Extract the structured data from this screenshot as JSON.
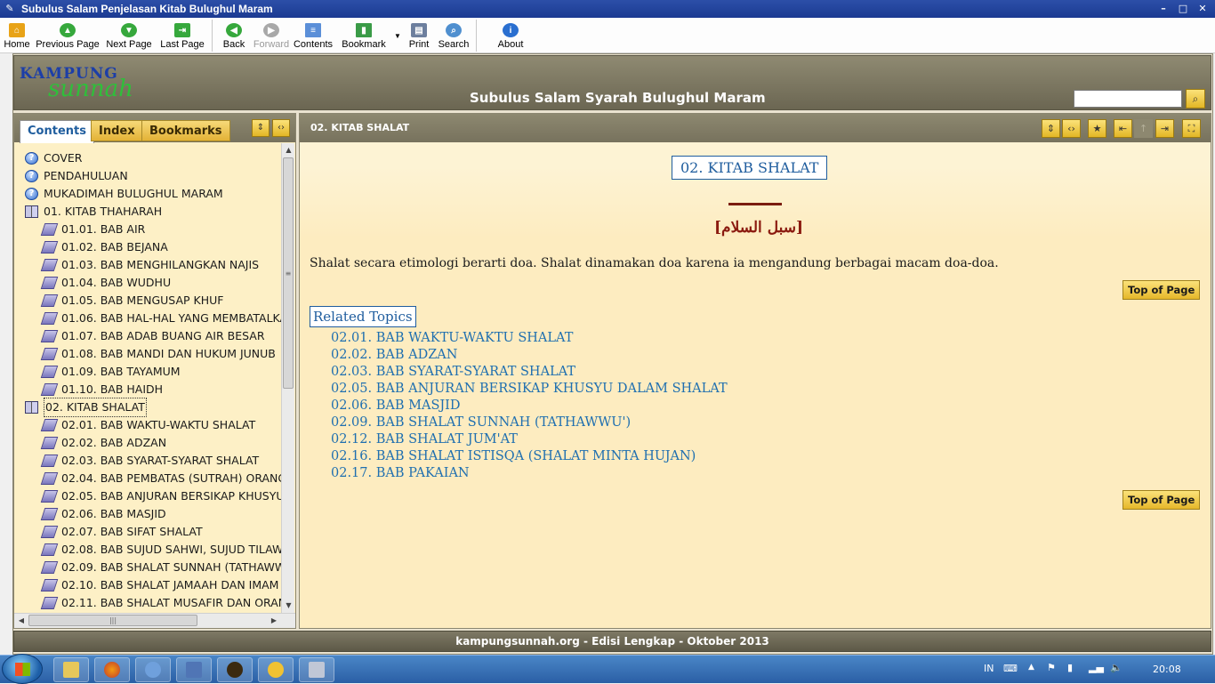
{
  "window": {
    "title": "Subulus Salam Penjelasan Kitab Bulughul Maram"
  },
  "toolbar": {
    "home": "Home",
    "previous_page": "Previous Page",
    "next_page": "Next Page",
    "last_page": "Last Page",
    "back": "Back",
    "forward": "Forward",
    "contents": "Contents",
    "bookmark": "Bookmark",
    "print": "Print",
    "search": "Search",
    "about": "About"
  },
  "header": {
    "logo_top": "KAMPUNG",
    "logo_bottom": "sunnah",
    "title": "Subulus Salam Syarah Bulughul Maram",
    "search_value": ""
  },
  "left_tabs": {
    "contents": "Contents",
    "index": "Index",
    "bookmarks": "Bookmarks"
  },
  "tree": [
    {
      "label": "COVER",
      "icon": "help-icon",
      "level": 0
    },
    {
      "label": "PENDAHULUAN",
      "icon": "help-icon",
      "level": 0
    },
    {
      "label": "MUKADIMAH BULUGHUL MARAM",
      "icon": "help-icon",
      "level": 0
    },
    {
      "label": "01. KITAB THAHARAH",
      "icon": "open-book-icon",
      "level": 0
    },
    {
      "label": "01.01. BAB AIR",
      "icon": "page-icon",
      "level": 1
    },
    {
      "label": "01.02. BAB BEJANA",
      "icon": "page-icon",
      "level": 1
    },
    {
      "label": "01.03. BAB MENGHILANGKAN NAJIS",
      "icon": "page-icon",
      "level": 1
    },
    {
      "label": "01.04. BAB WUDHU",
      "icon": "page-icon",
      "level": 1
    },
    {
      "label": "01.05. BAB MENGUSAP KHUF",
      "icon": "page-icon",
      "level": 1
    },
    {
      "label": "01.06. BAB HAL-HAL YANG MEMBATALKA",
      "icon": "page-icon",
      "level": 1
    },
    {
      "label": "01.07. BAB ADAB BUANG AIR BESAR",
      "icon": "page-icon",
      "level": 1
    },
    {
      "label": "01.08. BAB MANDI DAN HUKUM JUNUB",
      "icon": "page-icon",
      "level": 1
    },
    {
      "label": "01.09. BAB TAYAMUM",
      "icon": "page-icon",
      "level": 1
    },
    {
      "label": "01.10. BAB HAIDH",
      "icon": "page-icon",
      "level": 1
    },
    {
      "label": "02. KITAB SHALAT",
      "icon": "open-book-icon",
      "level": 0,
      "selected": true
    },
    {
      "label": "02.01. BAB WAKTU-WAKTU SHALAT",
      "icon": "page-icon",
      "level": 1
    },
    {
      "label": "02.02. BAB ADZAN",
      "icon": "page-icon",
      "level": 1
    },
    {
      "label": "02.03. BAB SYARAT-SYARAT SHALAT",
      "icon": "page-icon",
      "level": 1
    },
    {
      "label": "02.04. BAB PEMBATAS (SUTRAH) ORANG",
      "icon": "page-icon",
      "level": 1
    },
    {
      "label": "02.05. BAB ANJURAN BERSIKAP KHUSYU",
      "icon": "page-icon",
      "level": 1
    },
    {
      "label": "02.06. BAB MASJID",
      "icon": "page-icon",
      "level": 1
    },
    {
      "label": "02.07. BAB SIFAT SHALAT",
      "icon": "page-icon",
      "level": 1
    },
    {
      "label": "02.08. BAB SUJUD SAHWI, SUJUD TILAW",
      "icon": "page-icon",
      "level": 1
    },
    {
      "label": "02.09. BAB SHALAT SUNNAH (TATHAWW",
      "icon": "page-icon",
      "level": 1
    },
    {
      "label": "02.10. BAB SHALAT JAMAAH DAN IMAM",
      "icon": "page-icon",
      "level": 1
    },
    {
      "label": "02.11. BAB SHALAT MUSAFIR DAN ORAN",
      "icon": "page-icon",
      "level": 1
    }
  ],
  "content": {
    "header_title": "02. KITAB SHALAT",
    "page_title": "02. KITAB SHALAT",
    "arabic": "[سبل السلام]",
    "paragraph": "Shalat secara etimologi berarti doa. Shalat dinamakan doa karena ia mengandung berbagai macam doa-doa.",
    "top_of_page": "Top of Page",
    "related_title": "Related Topics",
    "related": [
      "02.01. BAB WAKTU-WAKTU SHALAT",
      "02.02. BAB ADZAN",
      "02.03. BAB SYARAT-SYARAT SHALAT",
      "02.05. BAB ANJURAN BERSIKAP KHUSYU DALAM SHALAT",
      "02.06. BAB MASJID",
      "02.09. BAB SHALAT SUNNAH (TATHAWWU')",
      "02.12. BAB SHALAT JUM'AT",
      "02.16. BAB SHALAT ISTISQA (SHALAT MINTA HUJAN)",
      "02.17. BAB PAKAIAN"
    ]
  },
  "footer": {
    "text": "kampungsunnah.org - Edisi Lengkap - Oktober 2013"
  },
  "taskbar": {
    "lang": "IN",
    "clock": "20:08"
  },
  "colors": {
    "accent_gold": "#e3b625",
    "link_blue": "#1f6fb0",
    "header_olive": "#7e7965",
    "arabic_red": "#8b1a0f"
  }
}
